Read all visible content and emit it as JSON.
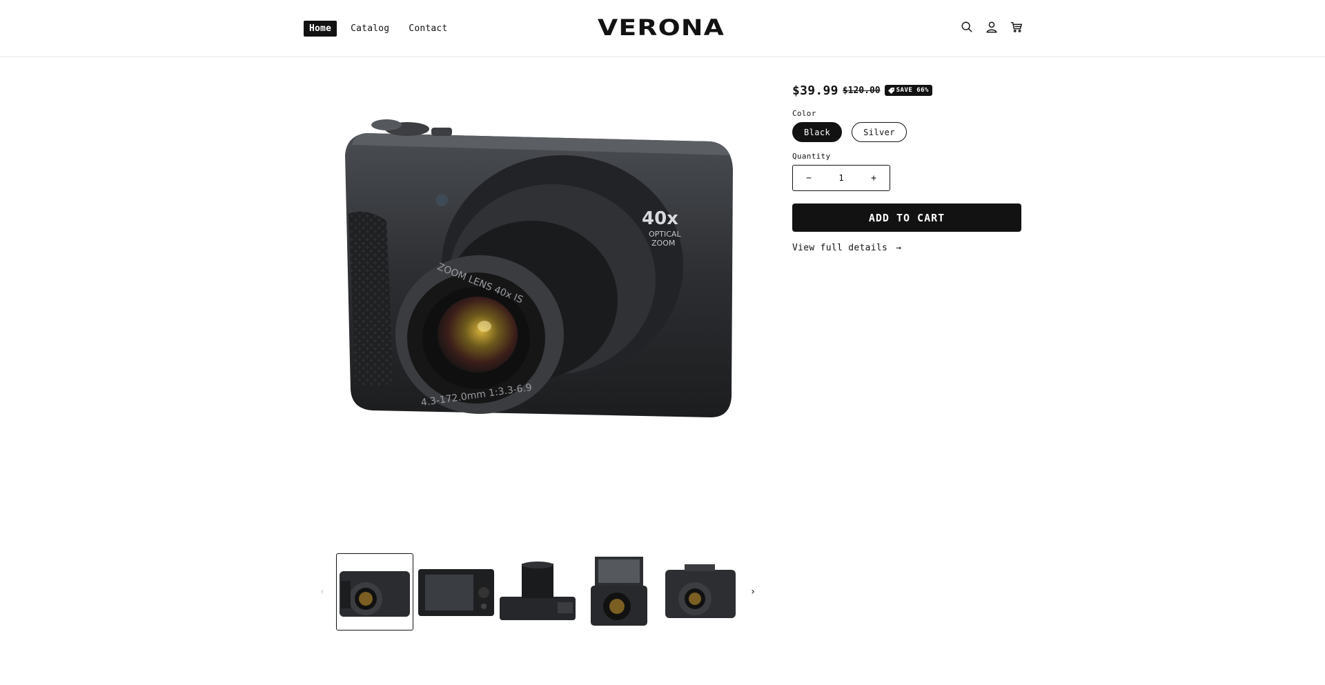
{
  "header": {
    "nav": [
      {
        "label": "Home"
      },
      {
        "label": "Catalog"
      },
      {
        "label": "Contact"
      }
    ],
    "logo": "VERONA",
    "icons": [
      "search-icon",
      "account-icon",
      "cart-icon"
    ]
  },
  "product": {
    "price": "$39.99",
    "compare_price": "$120.00",
    "badge": "SAVE 66%",
    "color_label": "Color",
    "colors": [
      {
        "label": "Black",
        "selected": true
      },
      {
        "label": "Silver",
        "selected": false
      }
    ],
    "quantity_label": "Quantity",
    "quantity": "1",
    "add_to_cart": "ADD TO CART",
    "details_link": "View full details",
    "details_arrow": "→"
  },
  "gallery": {
    "prev_arrow": "‹",
    "next_arrow": "›",
    "thumbnails": [
      "camera-front-angle",
      "camera-back-screen",
      "camera-top-lens",
      "camera-flip-screen",
      "camera-front-angle-2"
    ],
    "lens_text": "ZOOM LENS 40x IS",
    "lens_spec": "4.3-172.0mm 1:3.3-6.9",
    "zoom_big": "40x",
    "zoom_small1": "OPTICAL",
    "zoom_small2": "ZOOM"
  },
  "colors": {
    "accent": "#121212",
    "background": "#ffffff",
    "border": "#e6e6e6"
  }
}
